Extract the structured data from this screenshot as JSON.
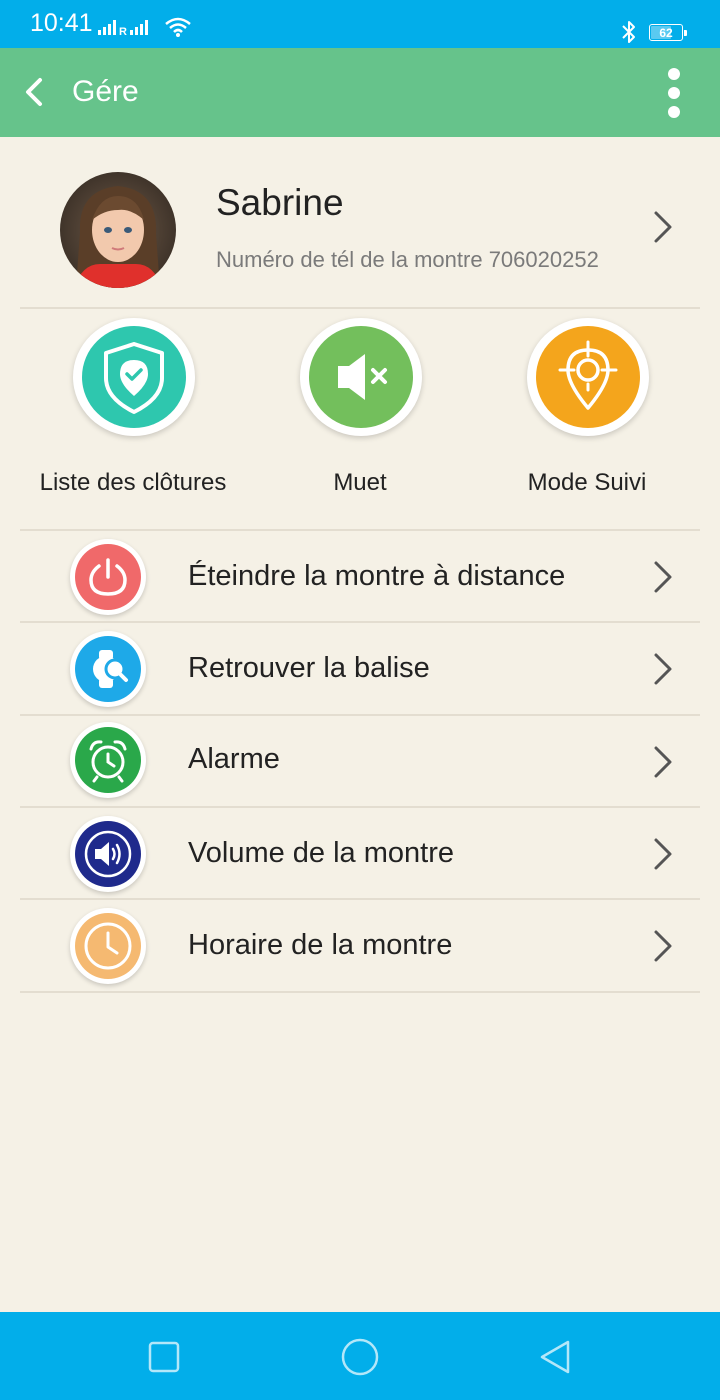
{
  "status_bar": {
    "time": "10:41",
    "network_letter": "R",
    "battery": "62",
    "icons": [
      "signal-icon",
      "wifi-icon",
      "bluetooth-icon",
      "battery-icon"
    ]
  },
  "app_bar": {
    "title": "Gére",
    "icons": [
      "back-arrow-icon",
      "more-vertical-icon"
    ],
    "color": "#66c38b"
  },
  "profile": {
    "name": "Sabrine",
    "subtitle": "Numéro de tél de la montre 706020252"
  },
  "quick_actions": [
    {
      "label": "Liste des clôtures",
      "icon": "shield-check-icon",
      "color": "#2ec7ae"
    },
    {
      "label": "Muet",
      "icon": "speaker-mute-icon",
      "color": "#73bf5c"
    },
    {
      "label": "Mode Suivi",
      "icon": "location-target-icon",
      "color": "#f4a51c"
    }
  ],
  "menu": [
    {
      "label": "Éteindre la montre à distance",
      "icon": "power-icon",
      "color": "#f0696a"
    },
    {
      "label": "Retrouver la balise",
      "icon": "watch-search-icon",
      "color": "#1ea9e8"
    },
    {
      "label": "Alarme",
      "icon": "alarm-clock-icon",
      "color": "#2aa84a"
    },
    {
      "label": "Volume de la montre",
      "icon": "volume-icon",
      "color": "#1f2a8c"
    },
    {
      "label": "Horaire de la montre",
      "icon": "clock-icon",
      "color": "#f5b971"
    }
  ],
  "nav_bar": {
    "buttons": [
      "recent-apps-icon",
      "home-icon",
      "back-triangle-icon"
    ],
    "color": "#02aeea"
  }
}
